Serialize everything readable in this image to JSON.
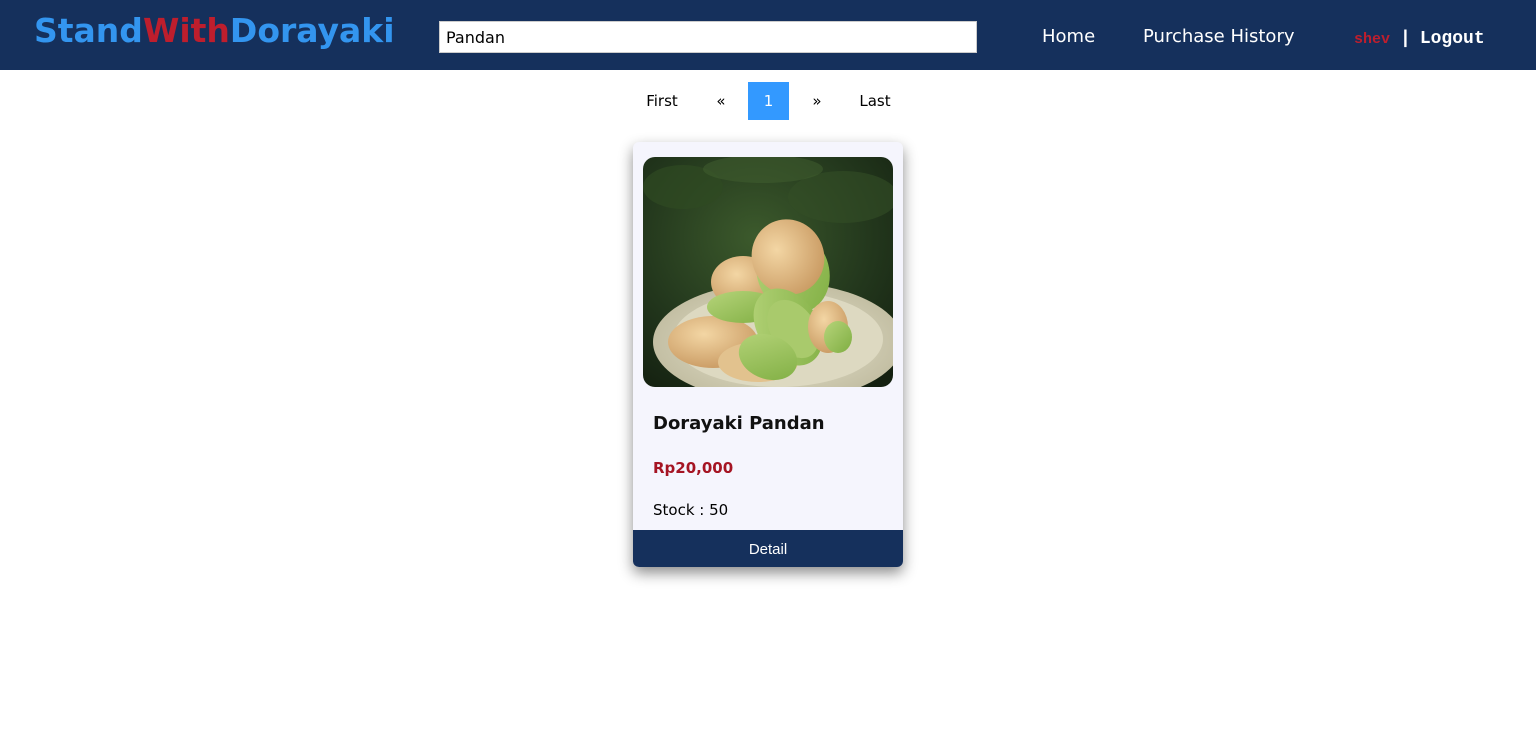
{
  "header": {
    "logo": {
      "part1": "Stand",
      "part2": "With",
      "part3": "Dorayaki"
    },
    "search": {
      "value": "Pandan"
    },
    "nav": {
      "home": "Home",
      "purchase_history": "Purchase History"
    },
    "user": {
      "username": "shev",
      "separator": "|",
      "logout": "Logout"
    }
  },
  "pagination": {
    "first": "First",
    "prev": "«",
    "current": "1",
    "next": "»",
    "last": "Last"
  },
  "products": [
    {
      "name": "Dorayaki Pandan",
      "price": "Rp20,000",
      "stock_label": "Stock : 50",
      "button_label": "Detail",
      "image_icon": "dorayaki-pandan-photo"
    }
  ],
  "colors": {
    "navbar": "#15305c",
    "logo_blue": "#3395ef",
    "logo_red": "#be1e2d",
    "page_active": "#3399ff",
    "price": "#a51423"
  }
}
